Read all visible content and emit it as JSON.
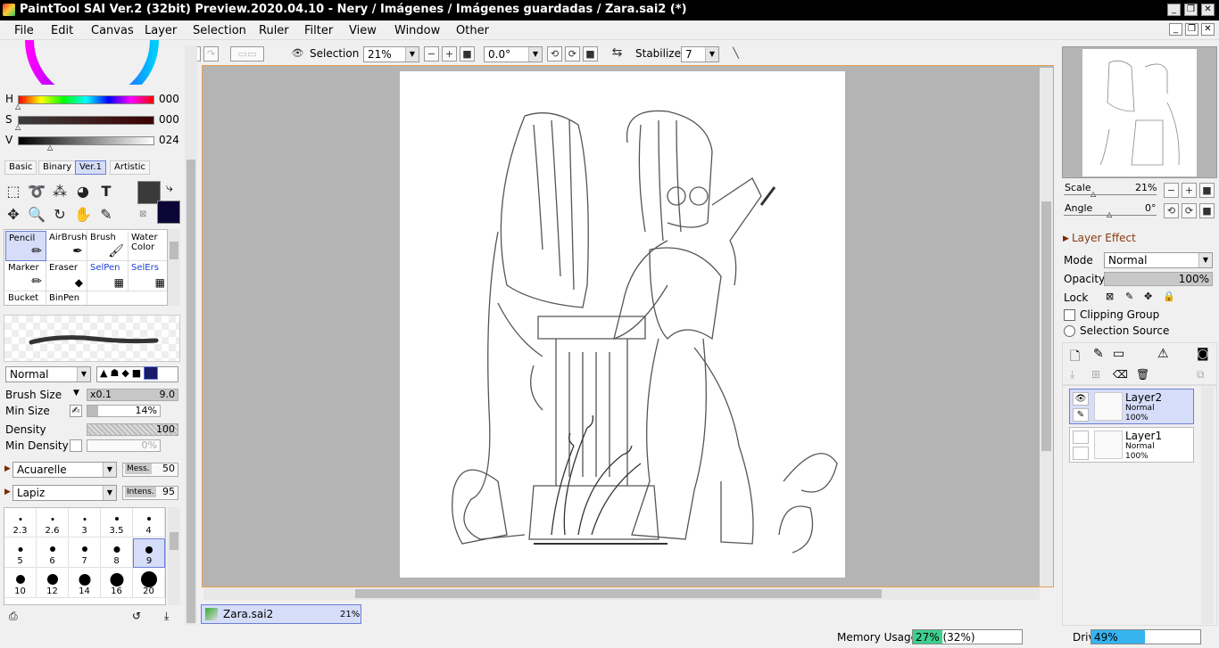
{
  "window": {
    "title": "PaintTool SAI Ver.2 (32bit) Preview.2020.04.10 - Nery / Imágenes / Imágenes guardadas / Zara.sai2 (*)",
    "buttons": [
      "_",
      "❐",
      "✕"
    ]
  },
  "menu": [
    "File",
    "Edit",
    "Canvas",
    "Layer",
    "Selection",
    "Ruler",
    "Filter",
    "View",
    "Window",
    "Other"
  ],
  "toolbar": {
    "selection_label": "Selection",
    "zoom": "21%",
    "rotation": "0.0°",
    "stabilizer_label": "Stabilizer",
    "stabilizer": "7"
  },
  "color": {
    "h_label": "H",
    "h_value": "000",
    "s_label": "S",
    "s_value": "000",
    "v_label": "V",
    "v_value": "024",
    "primary": "#3a3a3a",
    "secondary": "#0c0636"
  },
  "palette_tabs": [
    "Basic",
    "Binary",
    "Ver.1",
    "Artistic"
  ],
  "brushes": [
    {
      "label": "Pencil"
    },
    {
      "label": "AirBrush"
    },
    {
      "label": "Brush"
    },
    {
      "label": "Water Color"
    },
    {
      "label": "Marker"
    },
    {
      "label": "Eraser"
    },
    {
      "label": "SelPen"
    },
    {
      "label": "SelErs"
    },
    {
      "label": "Bucket"
    },
    {
      "label": "BinPen"
    }
  ],
  "brush_props": {
    "blend_mode": "Normal",
    "brush_size_label": "Brush Size",
    "brush_size_mult": "x0.1",
    "brush_size": "9.0",
    "min_size_label": "Min Size",
    "min_size": "14%",
    "density_label": "Density",
    "density": "100",
    "min_density_label": "Min Density",
    "min_density": "0%",
    "texture1": "Acuarelle",
    "mess_label": "Mess.",
    "mess": "50",
    "texture2": "Lapiz",
    "intens_label": "Intens.",
    "intens": "95"
  },
  "brush_sizes": [
    {
      "n": "2.3",
      "d": 3
    },
    {
      "n": "2.6",
      "d": 3
    },
    {
      "n": "3",
      "d": 3
    },
    {
      "n": "3.5",
      "d": 4
    },
    {
      "n": "4",
      "d": 4
    },
    {
      "n": "5",
      "d": 5
    },
    {
      "n": "6",
      "d": 6
    },
    {
      "n": "7",
      "d": 6
    },
    {
      "n": "8",
      "d": 7
    },
    {
      "n": "9",
      "d": 8
    },
    {
      "n": "10",
      "d": 10
    },
    {
      "n": "12",
      "d": 12
    },
    {
      "n": "14",
      "d": 13
    },
    {
      "n": "16",
      "d": 15
    },
    {
      "n": "20",
      "d": 18
    }
  ],
  "navigator": {
    "scale_label": "Scale",
    "scale": "21%",
    "angle_label": "Angle",
    "angle": "0°"
  },
  "layer_effect": {
    "title": "Layer Effect",
    "mode_label": "Mode",
    "mode": "Normal",
    "opacity_label": "Opacity",
    "opacity": "100%",
    "lock_label": "Lock",
    "clipping_label": "Clipping Group",
    "selection_source_label": "Selection Source"
  },
  "layers": [
    {
      "name": "Layer2",
      "mode": "Normal",
      "opacity": "100%"
    },
    {
      "name": "Layer1",
      "mode": "Normal",
      "opacity": "100%"
    }
  ],
  "doc_tab": {
    "name": "Zara.sai2",
    "zoom": "21%"
  },
  "status": {
    "memory_label": "Memory Usage",
    "memory": "27% (32%)",
    "memory_fill": 0.27,
    "drive_label": "Drive Usage",
    "drive": "49%",
    "drive_fill": 0.49
  }
}
